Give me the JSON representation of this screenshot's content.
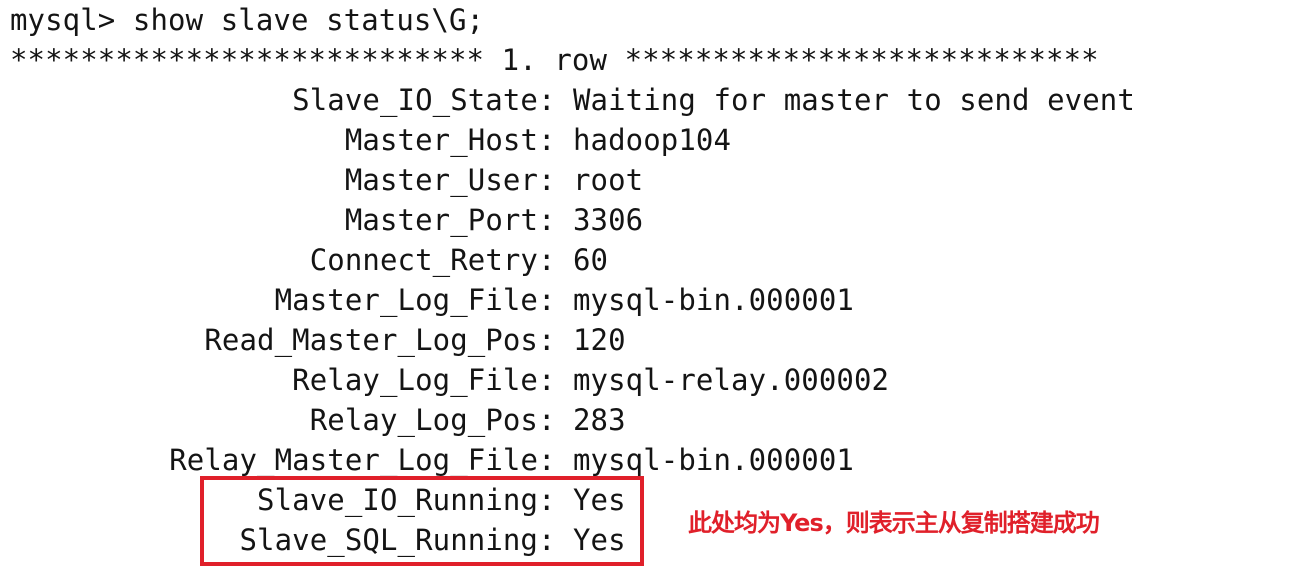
{
  "terminal": {
    "prompt": "mysql> ",
    "command": "show slave status\\G;",
    "row_header": "*************************** 1. row ***************************",
    "fields": [
      {
        "key": "Slave_IO_State",
        "value": "Waiting for master to send event"
      },
      {
        "key": "Master_Host",
        "value": "hadoop104"
      },
      {
        "key": "Master_User",
        "value": "root"
      },
      {
        "key": "Master_Port",
        "value": "3306"
      },
      {
        "key": "Connect_Retry",
        "value": "60"
      },
      {
        "key": "Master_Log_File",
        "value": "mysql-bin.000001"
      },
      {
        "key": "Read_Master_Log_Pos",
        "value": "120"
      },
      {
        "key": "Relay_Log_File",
        "value": "mysql-relay.000002"
      },
      {
        "key": "Relay_Log_Pos",
        "value": "283"
      },
      {
        "key": "Relay_Master_Log_File",
        "value": "mysql-bin.000001"
      },
      {
        "key": "Slave_IO_Running",
        "value": "Yes"
      },
      {
        "key": "Slave_SQL_Running",
        "value": "Yes"
      }
    ]
  },
  "annotation": {
    "text": "此处均为Yes，则表示主从复制搭建成功",
    "color": "#e0202a"
  }
}
